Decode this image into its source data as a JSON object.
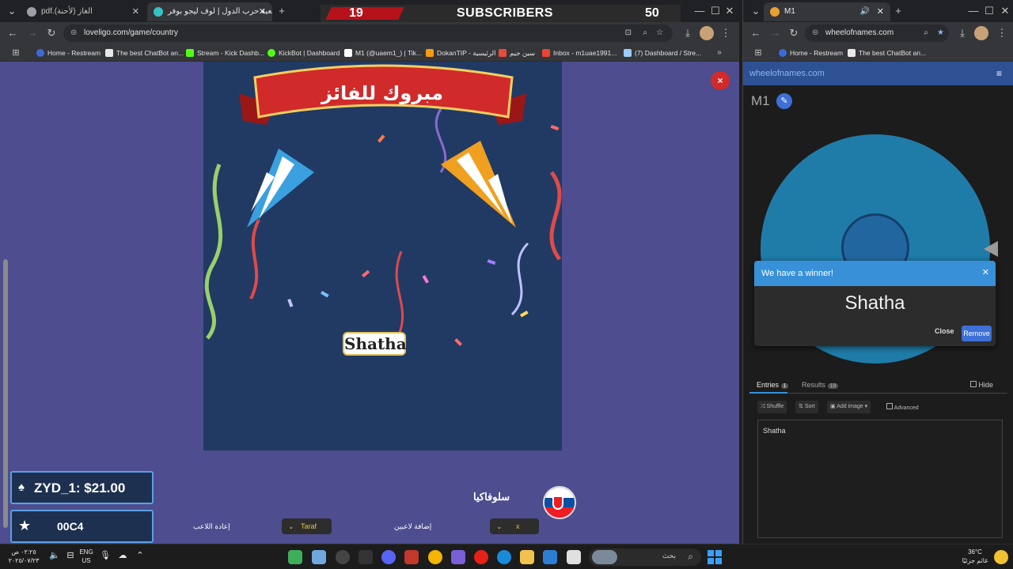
{
  "left_browser": {
    "tabs": [
      {
        "label": "pdf.الغاز (لأحنة)"
      },
      {
        "label": "لعبة حرب الدول | لوف ليجو بوفر"
      }
    ],
    "new_tab": "+",
    "url": "loveligo.com/game/country",
    "bookmarks": [
      {
        "label": "Home - Restream",
        "color": "#3b6bd6"
      },
      {
        "label": "The best ChatBot an...",
        "color": "#e8e8e8"
      },
      {
        "label": "Stream - Kick Dashb...",
        "color": "#53fc18"
      },
      {
        "label": "KickBot | Dashboard",
        "color": "#53fc18"
      },
      {
        "label": "M1 (@uaem1_) | Tik...",
        "color": "#ffffff"
      },
      {
        "label": "DokanTIP - الرئيسية",
        "color": "#f39c12"
      },
      {
        "label": "سين جيم",
        "color": "#e74c3c"
      },
      {
        "label": "Inbox - m1uae1991...",
        "color": "#ea4335"
      },
      {
        "label": "(7) Dashboard / Stre...",
        "color": "#9cf"
      }
    ]
  },
  "subscribers": {
    "left_count": "19",
    "label": "SUBSCRIBERS",
    "right_count": "50"
  },
  "game": {
    "banner_text": "مبروك للفائز",
    "winner_name": "Shatha",
    "close_symbol": "×",
    "currency_box": "ZYD_1: $21.00",
    "code_box": "00C4",
    "country_name": "سلوفاكيا",
    "restart_label": "إعادة اللاعب",
    "team_select": "Taraf",
    "add_players_label": "إضافة لاعبين",
    "player_select": "x"
  },
  "right_browser": {
    "tab_title": "M1",
    "url": "wheelofnames.com",
    "bookmarks": [
      {
        "label": "Home - Restream"
      },
      {
        "label": "The best ChatBot an..."
      }
    ],
    "site_header": "wheelofnames.com",
    "wheel_title": "M1",
    "winner_dialog": {
      "heading": "We have a winner!",
      "name": "Shatha",
      "close_label": "Close",
      "remove_label": "Remove"
    },
    "tabs": {
      "entries": "Entries",
      "entries_count": "1",
      "results": "Results",
      "results_count": "19",
      "hide": "Hide"
    },
    "toolbar": {
      "shuffle": "Shuffle",
      "sort": "Sort",
      "add_image": "Add image",
      "advanced": "Advanced"
    },
    "entries_text": "Shatha"
  },
  "taskbar": {
    "time": "٠٢:٢٥ ص",
    "date": "٢٠٢٥/٠٧/٢٣",
    "lang_top": "ENG",
    "lang_bottom": "US",
    "search_placeholder": "بحث",
    "temp": "36°C",
    "weather": "غائم جزئيًا"
  },
  "colors": {
    "accent_blue": "#3891d8",
    "game_bg": "#4d4d8f",
    "card_bg": "#213a64",
    "close_red": "#d22a2a"
  }
}
